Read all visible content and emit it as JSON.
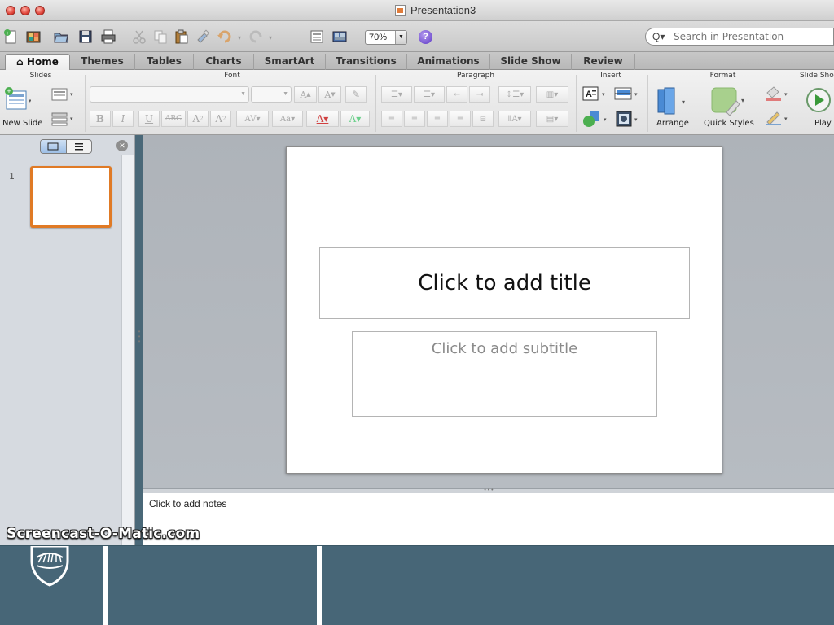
{
  "window": {
    "title": "Presentation3"
  },
  "toolbar": {
    "zoom": "70%",
    "help": "?"
  },
  "search": {
    "placeholder": "Search in Presentation"
  },
  "tabs": [
    "Home",
    "Themes",
    "Tables",
    "Charts",
    "SmartArt",
    "Transitions",
    "Animations",
    "Slide Show",
    "Review"
  ],
  "ribbon": {
    "groups": {
      "slides": "Slides",
      "font": "Font",
      "paragraph": "Paragraph",
      "insert": "Insert",
      "format": "Format",
      "slideshow": "Slide Sho"
    },
    "new_slide": "New Slide",
    "arrange": "Arrange",
    "quick_styles": "Quick Styles",
    "play": "Play"
  },
  "slides_panel": {
    "slide_number": "1"
  },
  "slide": {
    "title_placeholder": "Click to add title",
    "subtitle_placeholder": "Click to add subtitle"
  },
  "notes": {
    "placeholder": "Click to add notes"
  },
  "watermark": "Screencast-O-Matic.com",
  "colors": {
    "accent_orange": "#e07a25",
    "bottom_bar": "#476677",
    "selected_blue": "#9dbfe6"
  }
}
